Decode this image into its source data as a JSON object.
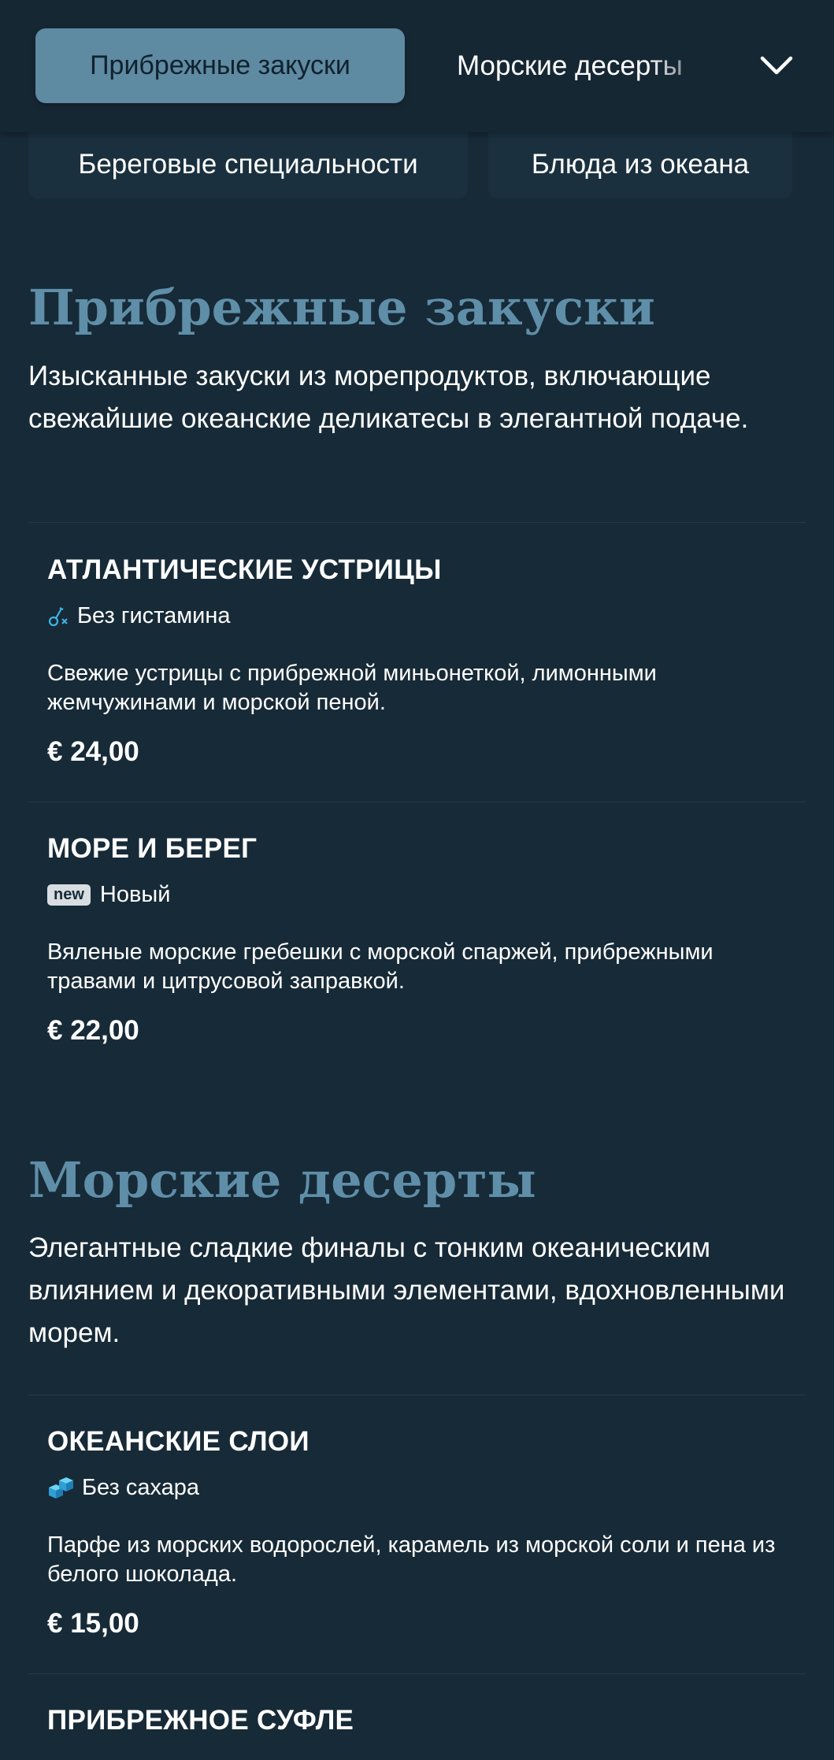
{
  "header": {
    "tabs": [
      {
        "label": "Прибрежные закуски",
        "active": true
      },
      {
        "label": "Морские десерты"
      },
      {
        "label": "Береговые специальности"
      },
      {
        "label": "Блюда из океана"
      }
    ]
  },
  "sections": [
    {
      "title": "Прибрежные закуски",
      "description": "Изысканные закуски из морепродуктов, включающие свежайшие океанские деликатесы в элегантной подаче.",
      "items": [
        {
          "name": "АТЛАНТИЧЕСКИЕ УСТРИЦЫ",
          "tag_icon": "histamine-free-icon",
          "tag": "Без гистамина",
          "description": "Свежие устрицы с прибрежной миньонеткой, лимонными жемчужинами и морской пеной.",
          "price": "€ 24,00"
        },
        {
          "name": "МОРЕ И БЕРЕГ",
          "tag_icon": "new-badge",
          "badge": "new",
          "tag": "Новый",
          "description": "Вяленые морские гребешки с морской спаржей, прибрежными травами и цитрусовой заправкой.",
          "price": "€ 22,00"
        }
      ]
    },
    {
      "title": "Морские десерты",
      "description": "Элегантные сладкие финалы с тонким океаническим влиянием и декоративными элементами, вдохновленными морем.",
      "items": [
        {
          "name": "ОКЕАНСКИЕ СЛОИ",
          "tag_icon": "sugar-free-icon",
          "tag": "Без сахара",
          "description": "Парфе из морских водорослей, карамель из морской соли и пена из белого шоколада.",
          "price": "€ 15,00"
        },
        {
          "name": "ПРИБРЕЖНОЕ СУФЛЕ"
        }
      ]
    }
  ],
  "colors": {
    "background": "#172a37",
    "accent": "#5f8ea8",
    "active_tab": "#5e8aa2"
  }
}
